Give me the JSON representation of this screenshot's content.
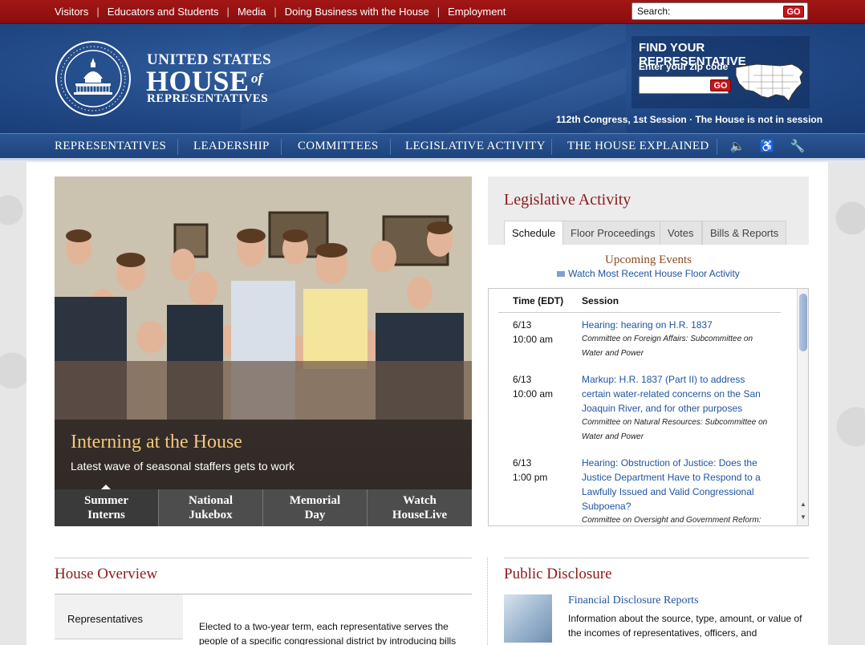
{
  "topbar": {
    "links": [
      "Visitors",
      "Educators and Students",
      "Media",
      "Doing Business with the House",
      "Employment"
    ],
    "search_label": "Search:",
    "search_go": "GO"
  },
  "header": {
    "logo_line1": "UNITED STATES",
    "logo_line2": "HOUSE",
    "logo_of": "of",
    "logo_line3": "REPRESENTATIVES",
    "find_rep_title": "FIND YOUR REPRESENTATIVE",
    "find_rep_zip_label": "Enter your zip code",
    "find_rep_go": "GO",
    "session_status": "112th Congress, 1st Session · The House is not in session"
  },
  "nav": {
    "items": [
      "REPRESENTATIVES",
      "LEADERSHIP",
      "COMMITTEES",
      "LEGISLATIVE ACTIVITY",
      "THE HOUSE EXPLAINED"
    ],
    "icons": [
      "speaker-icon",
      "accessibility-icon",
      "tools-icon"
    ]
  },
  "feature": {
    "title": "Interning at the House",
    "subtitle": "Latest wave of seasonal staffers gets to work",
    "tabs": [
      {
        "line1": "Summer",
        "line2": "Interns"
      },
      {
        "line1": "National",
        "line2": "Jukebox"
      },
      {
        "line1": "Memorial",
        "line2": "Day"
      },
      {
        "line1": "Watch",
        "line2": "HouseLive"
      }
    ],
    "active_tab": 0
  },
  "legislative": {
    "title": "Legislative Activity",
    "tabs": [
      "Schedule",
      "Floor Proceedings",
      "Votes",
      "Bills & Reports"
    ],
    "active_tab": 0,
    "upcoming": "Upcoming Events",
    "watch_link": "Watch Most Recent House Floor Activity",
    "col_time": "Time (EDT)",
    "col_session": "Session",
    "events": [
      {
        "date": "6/13",
        "time": "10:00 am",
        "title": "Hearing: hearing on H.R. 1837",
        "committee": "Committee on Foreign Affairs: Subcommittee on Water and Power"
      },
      {
        "date": "6/13",
        "time": "10:00 am",
        "title": "Markup: H.R. 1837 (Part II) to address certain water-related concerns on the San Joaquin River, and for other purposes",
        "committee": "Committee on Natural Resources: Subcommittee on Water and Power"
      },
      {
        "date": "6/13",
        "time": "1:00 pm",
        "title": "Hearing: Obstruction of Justice: Does the Justice Department Have to Respond to a Lawfully Issued and Valid Congressional Subpoena?",
        "committee": "Committee on Oversight and Government Reform:"
      }
    ]
  },
  "overview": {
    "title": "House Overview",
    "side_item": "Representatives",
    "text": "Elected to a two-year term, each representative serves the people of a specific congressional district by introducing bills"
  },
  "disclosure": {
    "title": "Public Disclosure",
    "link": "Financial Disclosure Reports",
    "text": "Information about the source, type, amount, or value of the incomes of representatives, officers, and"
  },
  "colors": {
    "red": "#8b1a1a",
    "blue": "#1d437d",
    "link": "#1f54a3",
    "gold": "#f3c77e"
  }
}
